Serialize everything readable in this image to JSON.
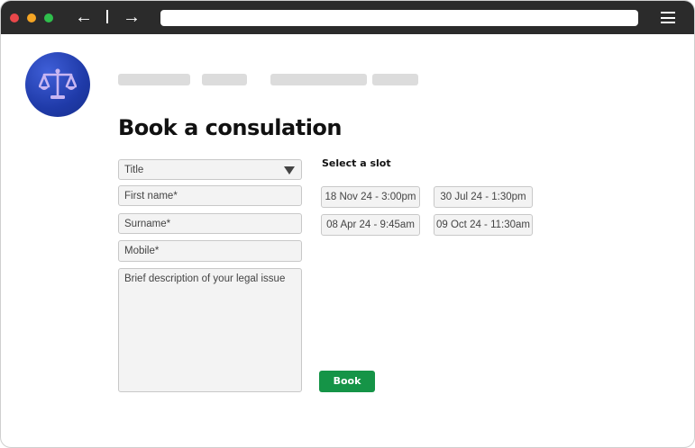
{
  "browser": {
    "colors": {
      "close": "#e9474a",
      "minimize": "#f5a524",
      "maximize": "#2fbf4c"
    },
    "icons": [
      "back-arrow-icon",
      "forward-arrow-icon",
      "hamburger-menu-icon"
    ],
    "back_glyph": "←",
    "forward_glyph": "→"
  },
  "logo": {
    "icon": "scales-of-justice-icon",
    "color": "#2445b8"
  },
  "page": {
    "title": "Book a consulation"
  },
  "form": {
    "title_select": "Title",
    "first_name_placeholder": "First name*",
    "surname_placeholder": "Surname*",
    "mobile_placeholder": "Mobile*",
    "description_placeholder": "Brief description of your legal issue"
  },
  "slots": {
    "heading": "Select a slot",
    "items": [
      "18 Nov 24 - 3:00pm",
      "30 Jul 24 - 1:30pm",
      "08 Apr 24 - 9:45am",
      "09 Oct 24 - 11:30am"
    ]
  },
  "actions": {
    "book_label": "Book",
    "book_color": "#159447"
  }
}
